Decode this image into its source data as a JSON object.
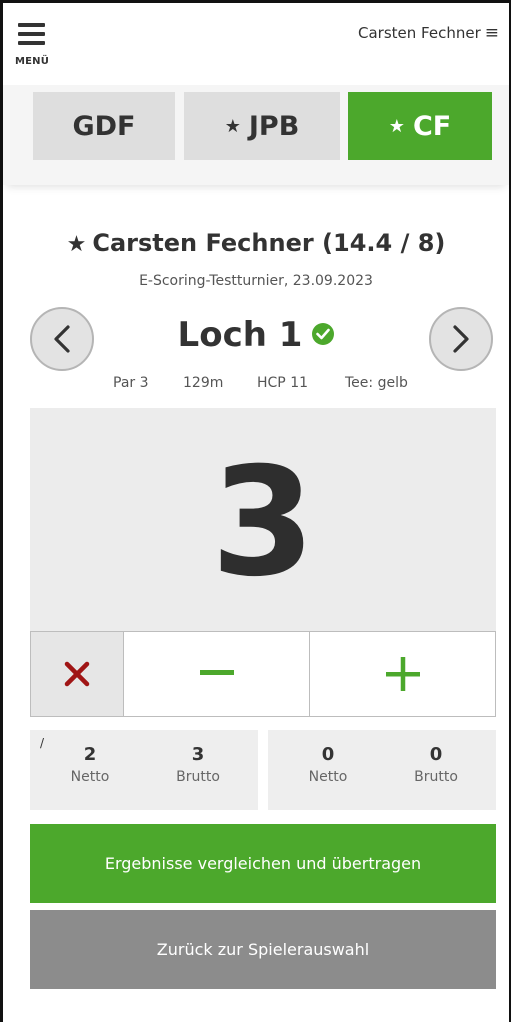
{
  "header": {
    "menu_label": "MENÜ",
    "user_name": "Carsten Fechner"
  },
  "tabs": [
    {
      "label": "GDF",
      "starred": false,
      "active": false
    },
    {
      "label": "JPB",
      "starred": true,
      "active": false
    },
    {
      "label": "CF",
      "starred": true,
      "active": true
    }
  ],
  "player": {
    "name": "Carsten Fechner (14.4 / 8)",
    "tournament": "E-Scoring-Testturnier, 23.09.2023"
  },
  "hole": {
    "title": "Loch 1",
    "par": "Par 3",
    "length": "129m",
    "hcp": "HCP 11",
    "tee": "Tee: gelb",
    "completed": true
  },
  "score": {
    "value": "3"
  },
  "totals": {
    "marker": "/",
    "left": {
      "netto_value": "2",
      "netto_label": "Netto",
      "brutto_value": "3",
      "brutto_label": "Brutto"
    },
    "right": {
      "netto_value": "0",
      "netto_label": "Netto",
      "brutto_value": "0",
      "brutto_label": "Brutto"
    }
  },
  "actions": {
    "compare_label": "Ergebnisse vergleichen und übertragen",
    "back_label": "Zurück zur Spielerauswahl"
  },
  "icons": {
    "menu": "hamburger-icon",
    "user_menu": "hamburger-icon",
    "star": "star-icon",
    "prev": "chevron-left-icon",
    "next": "chevron-right-icon",
    "check": "check-circle-icon",
    "clear": "close-icon",
    "minus": "minus-icon",
    "plus": "plus-icon"
  },
  "colors": {
    "accent_green": "#4ca82c",
    "clear_red": "#a01515",
    "back_gray": "#8c8c8c"
  }
}
